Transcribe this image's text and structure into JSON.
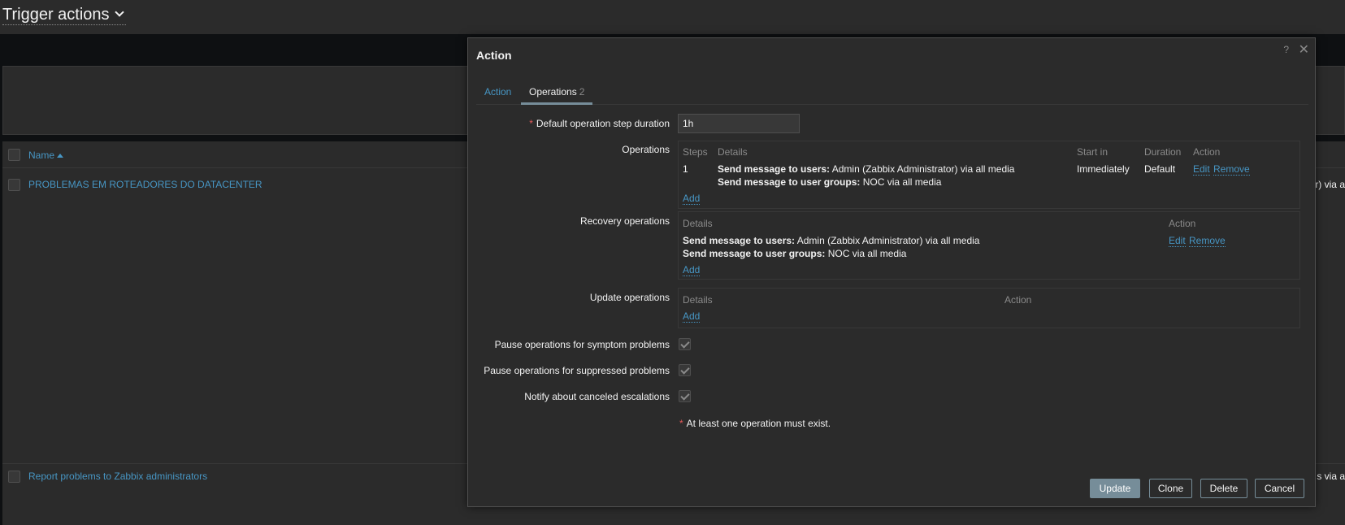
{
  "page": {
    "title": "Trigger actions",
    "list": {
      "name_header": "Name",
      "rows": [
        {
          "name": "PROBLEMAS EM ROTEADORES DO DATACENTER",
          "tail": "r) via a"
        },
        {
          "name": "Report problems to Zabbix administrators",
          "tail": "s via a"
        }
      ]
    }
  },
  "dialog": {
    "title": "Action",
    "help": "?",
    "close": "✕",
    "tabs": [
      {
        "label": "Action"
      },
      {
        "label": "Operations",
        "count": "2"
      }
    ],
    "form": {
      "step_duration_label": "Default operation step duration",
      "step_duration_value": "1h",
      "operations_label": "Operations",
      "operations": {
        "headers": [
          "Steps",
          "Details",
          "Start in",
          "Duration",
          "Action"
        ],
        "rows": [
          {
            "steps": "1",
            "detail1_bold": "Send message to users:",
            "detail1_text": " Admin (Zabbix Administrator) via all media",
            "detail2_bold": "Send message to user groups:",
            "detail2_text": " NOC via all media",
            "start_in": "Immediately",
            "duration": "Default",
            "edit": "Edit",
            "remove": "Remove"
          }
        ],
        "add": "Add"
      },
      "recovery_label": "Recovery operations",
      "recovery": {
        "headers": [
          "Details",
          "Action"
        ],
        "detail1_bold": "Send message to users:",
        "detail1_text": " Admin (Zabbix Administrator) via all media",
        "detail2_bold": "Send message to user groups:",
        "detail2_text": " NOC via all media",
        "edit": "Edit",
        "remove": "Remove",
        "add": "Add"
      },
      "update_label": "Update operations",
      "update": {
        "headers": [
          "Details",
          "Action"
        ],
        "add": "Add"
      },
      "pause_symptom_label": "Pause operations for symptom problems",
      "pause_suppressed_label": "Pause operations for suppressed problems",
      "notify_canceled_label": "Notify about canceled escalations",
      "checkboxes_checked": true,
      "note": "At least one operation must exist."
    },
    "buttons": {
      "update": "Update",
      "clone": "Clone",
      "delete": "Delete",
      "cancel": "Cancel"
    }
  }
}
